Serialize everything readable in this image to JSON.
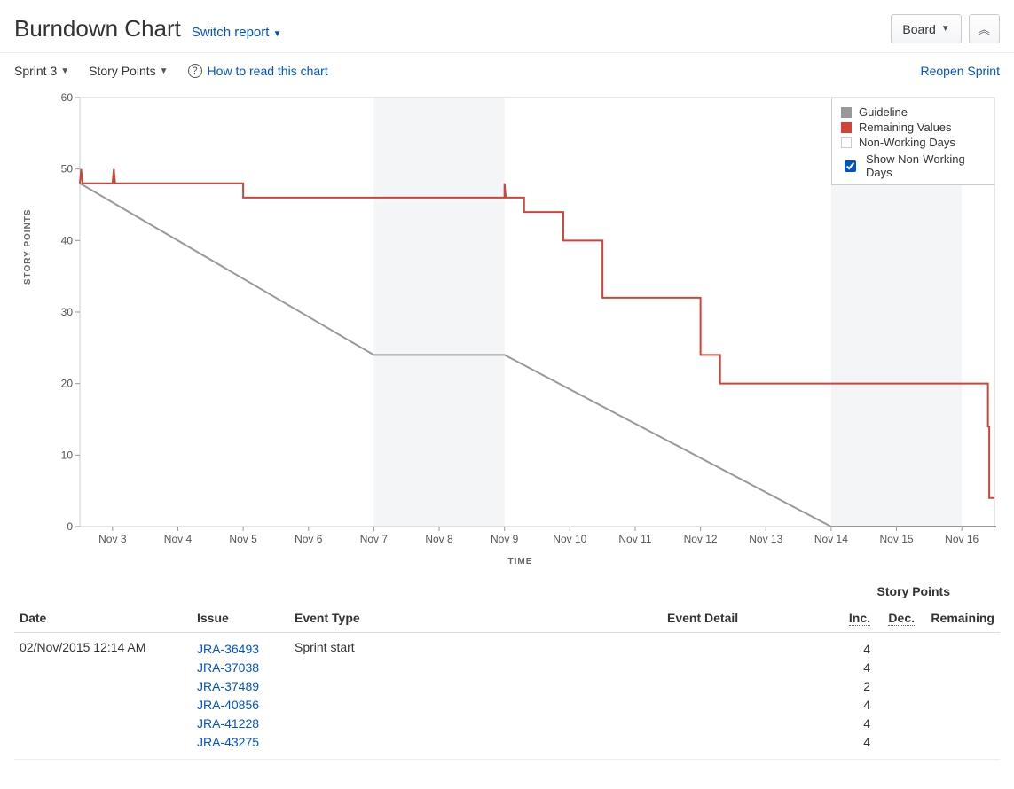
{
  "header": {
    "title": "Burndown Chart",
    "switch_report": "Switch report",
    "board_button": "Board",
    "collapse_tooltip": "Collapse"
  },
  "toolbar": {
    "sprint": "Sprint 3",
    "estimate": "Story Points",
    "how_to": "How to read this chart",
    "reopen": "Reopen Sprint"
  },
  "chart": {
    "ylabel": "STORY POINTS",
    "xlabel": "TIME",
    "legend": {
      "guideline": "Guideline",
      "remaining": "Remaining Values",
      "nonworking": "Non-Working Days",
      "show_nonworking": "Show Non-Working Days"
    }
  },
  "chart_data": {
    "type": "line",
    "xlabel": "TIME",
    "ylabel": "STORY POINTS",
    "ylim": [
      0,
      60
    ],
    "yticks": [
      0,
      10,
      20,
      30,
      40,
      50,
      60
    ],
    "categories": [
      "Nov 3",
      "Nov 4",
      "Nov 5",
      "Nov 6",
      "Nov 7",
      "Nov 8",
      "Nov 9",
      "Nov 10",
      "Nov 11",
      "Nov 12",
      "Nov 13",
      "Nov 14",
      "Nov 15",
      "Nov 16"
    ],
    "nonworking_ranges": [
      [
        4,
        6
      ],
      [
        11,
        13
      ]
    ],
    "series": [
      {
        "name": "Guideline",
        "color": "#999999",
        "step": false,
        "points": [
          [
            -0.5,
            48
          ],
          [
            4,
            24
          ],
          [
            6,
            24
          ],
          [
            11,
            0
          ],
          [
            14,
            0
          ]
        ]
      },
      {
        "name": "Remaining Values",
        "color": "#d04437",
        "step": true,
        "points": [
          [
            -0.5,
            48
          ],
          [
            -0.48,
            50
          ],
          [
            -0.46,
            48
          ],
          [
            0,
            48
          ],
          [
            0.02,
            50
          ],
          [
            0.04,
            48
          ],
          [
            2,
            48
          ],
          [
            2,
            46
          ],
          [
            6,
            46
          ],
          [
            6,
            48
          ],
          [
            6.02,
            46
          ],
          [
            6.3,
            46
          ],
          [
            6.3,
            44
          ],
          [
            6.9,
            44
          ],
          [
            6.9,
            40
          ],
          [
            7.5,
            40
          ],
          [
            7.5,
            32
          ],
          [
            9,
            32
          ],
          [
            9,
            24
          ],
          [
            9.3,
            24
          ],
          [
            9.3,
            20
          ],
          [
            13.4,
            20
          ],
          [
            13.4,
            14
          ],
          [
            13.42,
            14
          ],
          [
            13.42,
            4
          ],
          [
            13.5,
            4
          ]
        ]
      }
    ]
  },
  "table": {
    "story_points_header": "Story Points",
    "columns": {
      "date": "Date",
      "issue": "Issue",
      "event_type": "Event Type",
      "event_detail": "Event Detail",
      "inc": "Inc.",
      "dec": "Dec.",
      "remaining": "Remaining"
    },
    "rows": [
      {
        "date": "02/Nov/2015 12:14 AM",
        "issues": [
          "JRA-36493",
          "JRA-37038",
          "JRA-37489",
          "JRA-40856",
          "JRA-41228",
          "JRA-43275"
        ],
        "event_type": "Sprint start",
        "event_detail": "",
        "inc": [
          "4",
          "4",
          "2",
          "4",
          "4",
          "4"
        ],
        "dec": [],
        "remaining": ""
      }
    ]
  }
}
